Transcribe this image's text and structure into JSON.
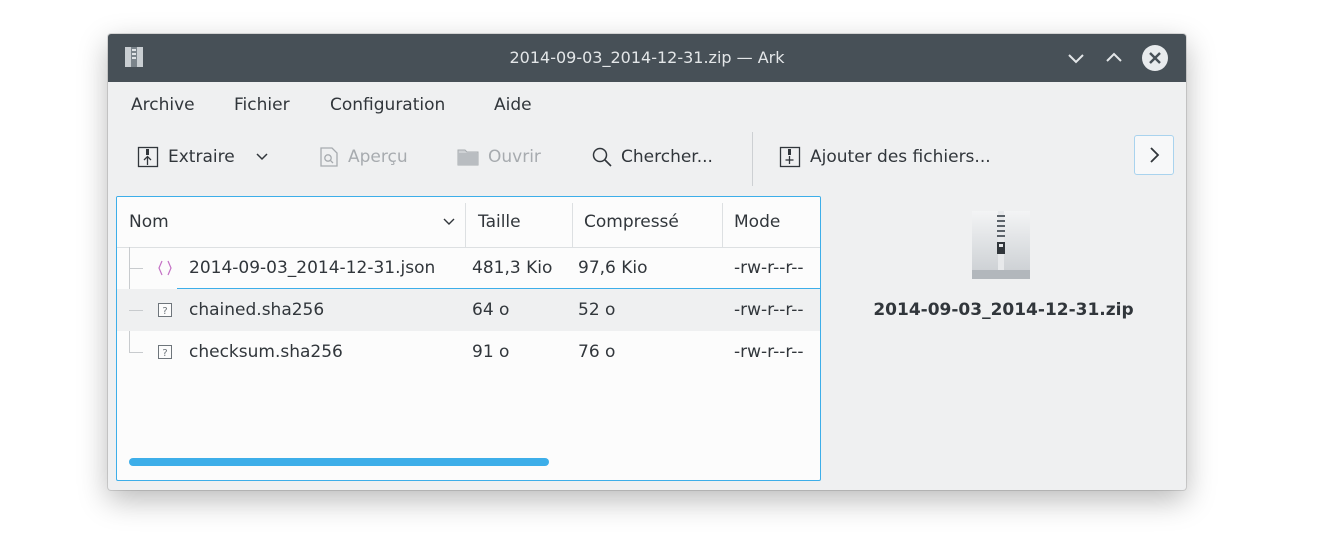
{
  "window": {
    "title": "2014-09-03_2014-12-31.zip — Ark",
    "icons": {
      "app": "ark-archive-icon",
      "minimize": "chevron-down-icon",
      "maximize": "chevron-up-icon",
      "close": "close-icon"
    }
  },
  "menubar": {
    "items": [
      {
        "label": "Archive"
      },
      {
        "label": "Fichier"
      },
      {
        "label": "Configuration"
      },
      {
        "label": "Aide"
      }
    ]
  },
  "toolbar": {
    "extract": {
      "label": "Extraire",
      "icon": "extract-icon",
      "dropdown_icon": "chevron-down-icon"
    },
    "preview": {
      "label": "Aperçu",
      "icon": "preview-icon",
      "enabled": false
    },
    "open": {
      "label": "Ouvrir",
      "icon": "folder-icon",
      "enabled": false
    },
    "search": {
      "label": "Chercher...",
      "icon": "search-icon"
    },
    "add_files": {
      "label": "Ajouter des fichiers...",
      "icon": "add-files-icon"
    },
    "more_icon": "chevron-right-icon"
  },
  "file_list": {
    "columns": [
      "Nom",
      "Taille",
      "Compressé",
      "Mode"
    ],
    "sort_icon": "chevron-down-icon",
    "rows": [
      {
        "name": "2014-09-03_2014-12-31.json",
        "size": "481,3 Kio",
        "compressed": "97,6 Kio",
        "mode": "-rw-r--r--",
        "icon": "json-file-icon"
      },
      {
        "name": "chained.sha256",
        "size": "64 o",
        "compressed": "52 o",
        "mode": "-rw-r--r--",
        "icon": "unknown-file-icon"
      },
      {
        "name": "checksum.sha256",
        "size": "91 o",
        "compressed": "76 o",
        "mode": "-rw-r--r--",
        "icon": "unknown-file-icon"
      }
    ]
  },
  "preview_panel": {
    "filename": "2014-09-03_2014-12-31.zip",
    "icon": "zip-archive-icon"
  },
  "colors": {
    "titlebar": "#475057",
    "accent": "#3daee9",
    "window_bg": "#eff0f1",
    "text": "#31363b",
    "disabled_text": "#a7abaf"
  }
}
